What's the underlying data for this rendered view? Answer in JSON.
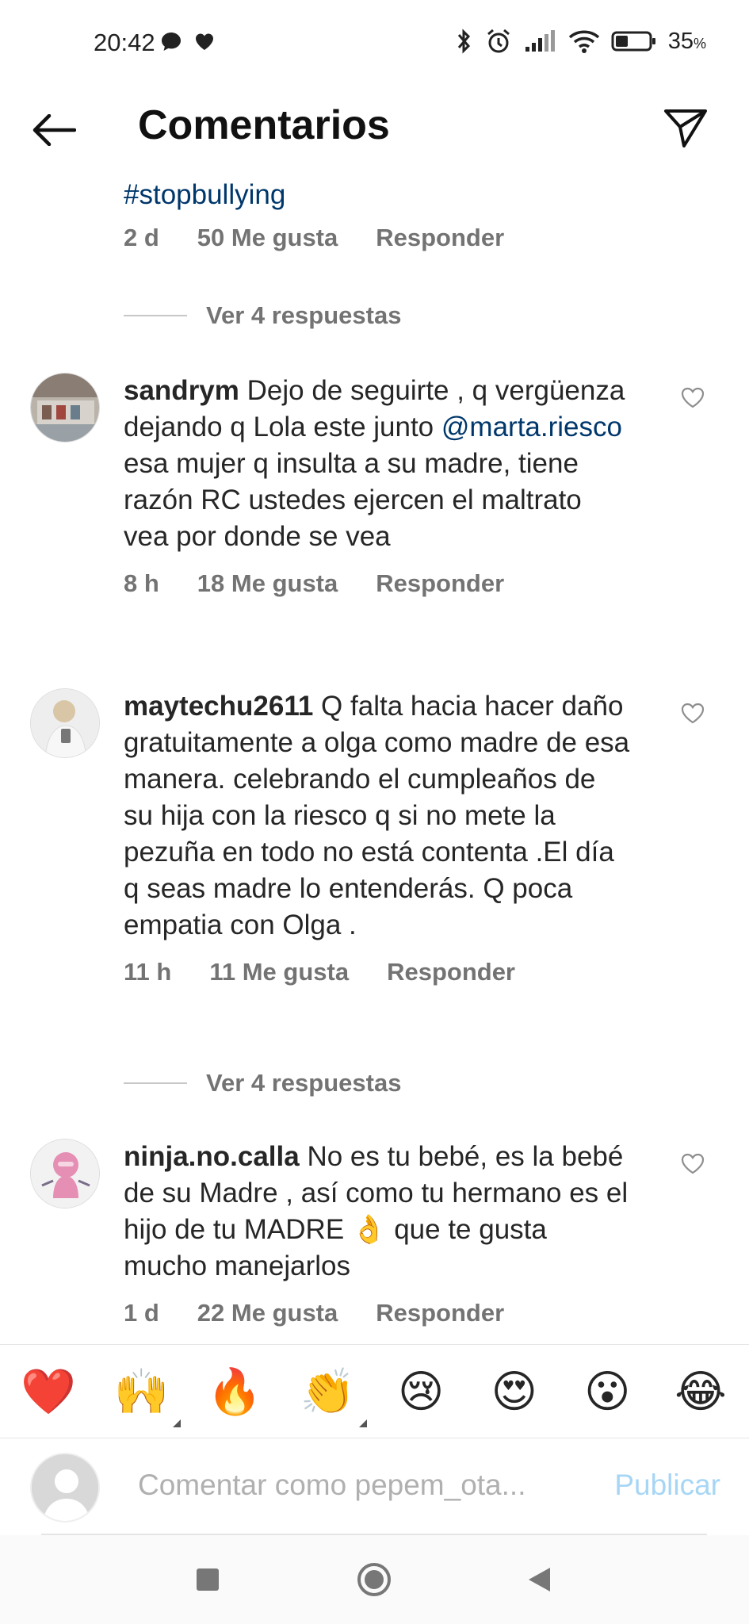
{
  "status_bar": {
    "time": "20:42",
    "battery": "35",
    "battery_unit": "%"
  },
  "header": {
    "title": "Comentarios"
  },
  "top_comment_tail": {
    "text": "#stopbullying",
    "time": "2 d",
    "likes": "50 Me gusta",
    "reply": "Responder"
  },
  "replies_1": {
    "label": "Ver 4 respuestas"
  },
  "comments": [
    {
      "username": "sandrym",
      "text_before": " Dejo de seguirte , q vergüenza dejando q Lola este junto ",
      "mention": "@marta.riesco",
      "text_after": "  esa mujer q insulta a su madre, tiene  razón RC ustedes ejercen el maltrato vea por donde se vea",
      "time": "8 h",
      "likes": "18 Me gusta",
      "reply": "Responder"
    },
    {
      "username": "maytechu2611",
      "text": " Q falta hacia hacer daño gratuitamente a olga como madre de esa manera. celebrando el cumpleaños de su hija con la riesco q si no mete la pezuña en todo no está contenta .El día q seas madre lo entenderás. Q poca empatia con Olga .",
      "time": "11 h",
      "likes": "11 Me gusta",
      "reply": "Responder"
    },
    {
      "username": "ninja.no.calla",
      "text": " No es tu bebé, es la bebé de su Madre , así como tu hermano es el hijo de tu MADRE 👌 que te gusta mucho manejarlos",
      "time": "1 d",
      "likes": "22 Me gusta",
      "reply": "Responder"
    }
  ],
  "replies_2": {
    "label": "Ver 4 respuestas"
  },
  "emojis": [
    "❤️",
    "🙌",
    "🔥",
    "👏",
    "😢",
    "😍",
    "😮",
    "😂"
  ],
  "composer": {
    "placeholder": "Comentar como pepem_ota...",
    "publish_label": "Publicar"
  },
  "colors": {
    "link": "#00376b",
    "meta": "#737373",
    "publish_disabled": "#a7d6f5"
  }
}
